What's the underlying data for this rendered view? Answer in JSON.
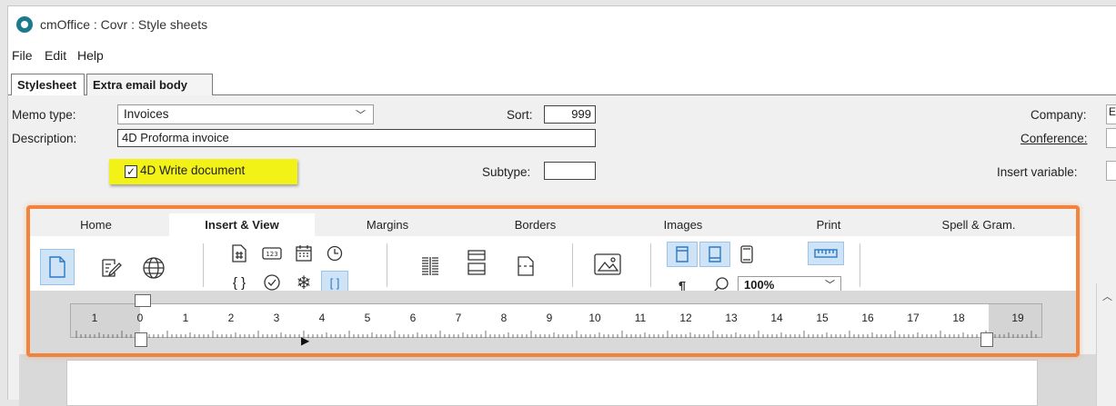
{
  "window": {
    "title": "cmOffice : Covr : Style sheets"
  },
  "menu": [
    "File",
    "Edit",
    "Help"
  ],
  "doc_tabs": [
    "Stylesheet",
    "Extra email body"
  ],
  "form": {
    "memo_type_label": "Memo type:",
    "memo_type_value": "Invoices",
    "description_label": "Description:",
    "description_value": "4D Proforma invoice",
    "checkbox_label": "4D Write document",
    "checkbox_checked": true,
    "highlight_color": "#f2f216",
    "sort_label": "Sort:",
    "sort_value": "999",
    "subtype_label": "Subtype:",
    "subtype_value": "",
    "company_label": "Company:",
    "company_value": "E",
    "conference_label": "Conference:",
    "insert_variable_label": "Insert variable:"
  },
  "ribbon": {
    "border_color": "#f0843c",
    "tabs": [
      "Home",
      "Insert & View",
      "Margins",
      "Borders",
      "Images",
      "Print",
      "Spell & Gram."
    ],
    "active_tab": "Insert & View",
    "checkmark": "✓",
    "zoom_value": "100%",
    "pilcrow": "¶",
    "icons": [
      "page-icon",
      "edit-icon",
      "globe-icon",
      "page-number-icon",
      "numbering-icon",
      "calendar-icon",
      "clock-icon",
      "braces-icon",
      "check-circle-icon",
      "snowflake-icon",
      "brackets-icon",
      "columns-icon",
      "header-footer-icon",
      "page-break-icon",
      "image-icon",
      "header-view-icon",
      "footer-view-icon",
      "page-view-icon",
      "ruler-icon",
      "pilcrow-icon",
      "zoom-icon"
    ]
  },
  "ruler": {
    "numbers": [
      "1",
      "0",
      "1",
      "2",
      "3",
      "4",
      "5",
      "6",
      "7",
      "8",
      "9",
      "10",
      "11",
      "12",
      "13",
      "14",
      "15",
      "16",
      "17",
      "18",
      "19"
    ]
  }
}
